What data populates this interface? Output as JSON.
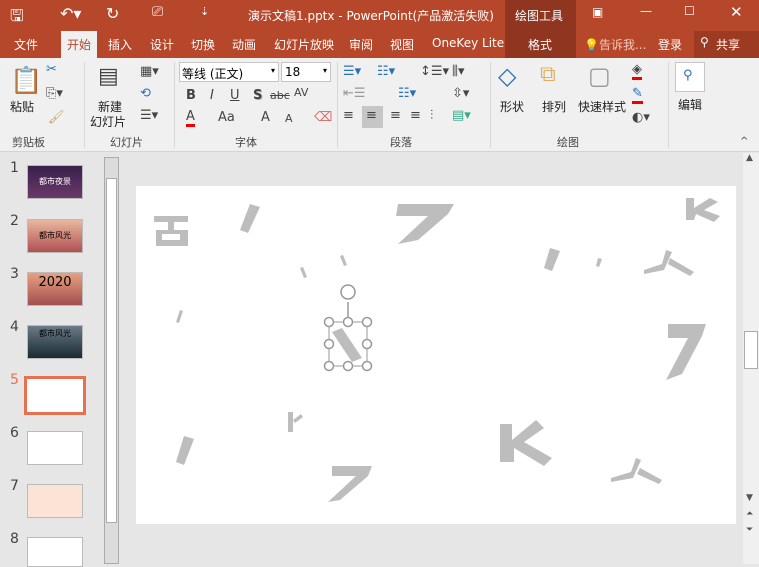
{
  "title": "演示文稿1.pptx - PowerPoint(产品激活失败)",
  "context_tab": "绘图工具",
  "tabs": [
    "文件",
    "开始",
    "插入",
    "设计",
    "切换",
    "动画",
    "幻灯片放映",
    "审阅",
    "视图",
    "OneKey Lite",
    "格式"
  ],
  "tell_me": "告诉我...",
  "login": "登录",
  "share": "共享",
  "ribbon": {
    "clipboard": {
      "paste": "粘贴",
      "group": "剪贴板"
    },
    "slides": {
      "new_slide_1": "新建",
      "new_slide_2": "幻灯片",
      "group": "幻灯片"
    },
    "font": {
      "font_name": "等线 (正文)",
      "font_size": "18",
      "bold": "B",
      "italic": "I",
      "underline": "U",
      "shadow": "S",
      "strike": "abc",
      "spacing": "AV",
      "color": "A",
      "case": "Aa",
      "grow": "A",
      "shrink": "A",
      "group": "字体"
    },
    "paragraph": {
      "group": "段落"
    },
    "drawing": {
      "shapes": "形状",
      "arrange": "排列",
      "quick_styles": "快速样式",
      "group": "绘图"
    },
    "editing": {
      "edit": "编辑"
    }
  },
  "slides": [
    {
      "num": "1",
      "text": "都市夜景"
    },
    {
      "num": "2",
      "text": "都市风光"
    },
    {
      "num": "3",
      "text": "2020"
    },
    {
      "num": "4",
      "text": "都市风光"
    },
    {
      "num": "5",
      "text": ""
    },
    {
      "num": "6",
      "text": ""
    },
    {
      "num": "7",
      "text": ""
    },
    {
      "num": "8",
      "text": ""
    }
  ],
  "selected_slide": "5",
  "colors": {
    "accent": "#b7472a",
    "selected": "#e8704f",
    "shape": "#bdbdbd"
  }
}
